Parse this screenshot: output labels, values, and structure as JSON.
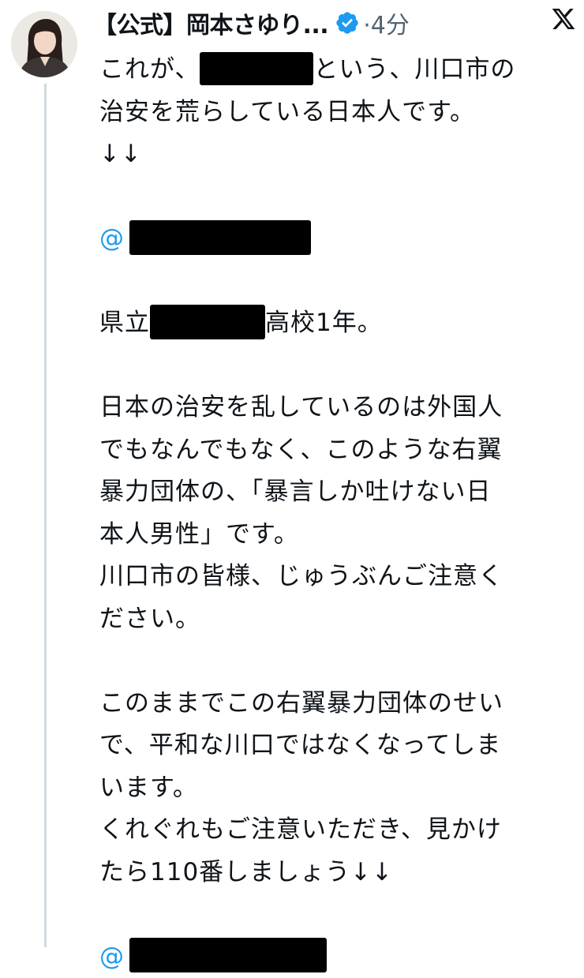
{
  "post": {
    "author": {
      "display_name": "【公式】岡本さゆり...",
      "verified": true,
      "time": "·4分"
    },
    "brand": "x-logo-icon",
    "lines": {
      "l1_pre": "これが、",
      "l1_post": "という、川口市の",
      "l2": "治安を荒らしている日本人です。",
      "l3": "↓↓",
      "mention_prefix": "@",
      "l5_pre": "県立",
      "l5_post": "高校1年。",
      "l6": "日本の治安を乱しているのは外国人",
      "l7": "でもなんでもなく、このような右翼",
      "l8": "暴力団体の、「暴言しか吐けない日",
      "l9": "本人男性」です。",
      "l10": "川口市の皆様、じゅうぶんご注意く",
      "l11": "ださい。",
      "l12": "このままでこの右翼暴力団体のせい",
      "l13": "で、平和な川口ではなくなってしま",
      "l14": "います。",
      "l15": "くれぐれもご注意いただき、見かけ",
      "l16": "たら110番しましょう↓↓",
      "mention2_prefix": "@"
    }
  },
  "colors": {
    "text": "#0f1419",
    "muted": "#536471",
    "accent": "#1d9bf0",
    "thread_line": "#cfd9de",
    "redaction": "#000000"
  }
}
